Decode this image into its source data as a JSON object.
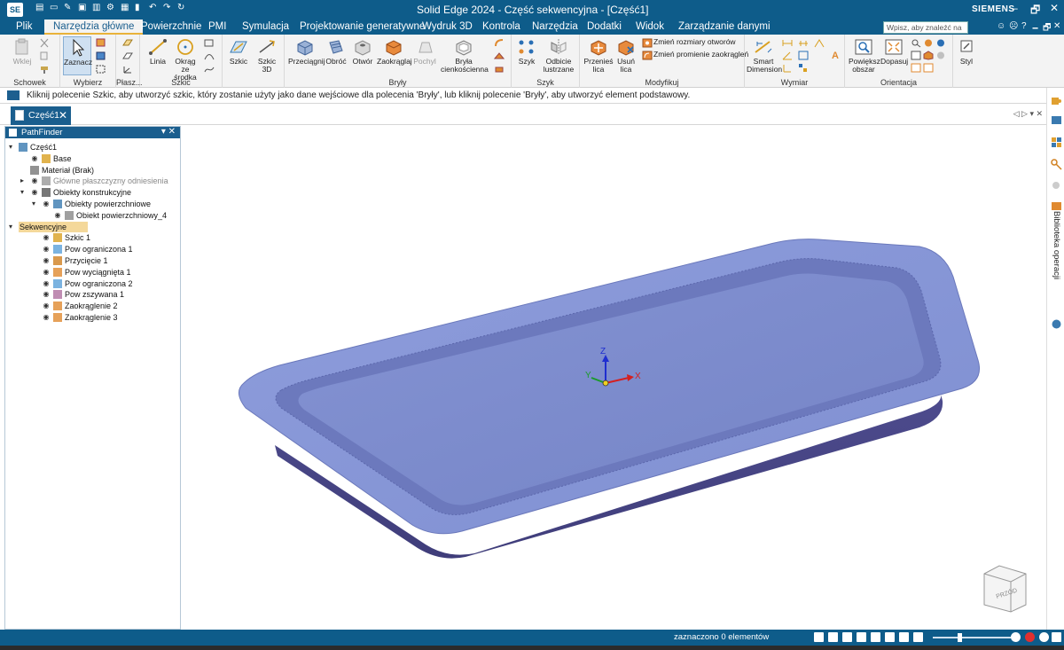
{
  "app": {
    "logo": "SE",
    "title": "Solid Edge 2024 - Część sekwencyjna - [Część1]",
    "brand": "SIEMENS",
    "window_controls": [
      "–",
      "🗗",
      "✕"
    ]
  },
  "menu": {
    "tabs": [
      "Plik",
      "Narzędzia główne",
      "Powierzchnie",
      "PMI",
      "Symulacja",
      "Projektowanie generatywne",
      "Wydruk 3D",
      "Kontrola",
      "Narzędzia",
      "Dodatki",
      "Widok",
      "Zarządzanie danymi"
    ],
    "active_tab": "Narzędzia główne",
    "search_placeholder": "Wpisz, aby znaleźć na",
    "right_controls": [
      "🗕",
      "🗗",
      "✕"
    ]
  },
  "ribbon": {
    "groups": {
      "schowek": "Schowek",
      "wybierz": "Wybierz",
      "plasz": "Płasz...",
      "szkic": "Szkic",
      "bryly": "Bryły",
      "szyk": "Szyk",
      "modyfikuj": "Modyfikuj",
      "wymiar": "Wymiar",
      "orientacja": "Orientacja"
    },
    "buttons": {
      "wklej": "Wklej",
      "zaznacz": "Zaznacz",
      "linia": "Linia",
      "okrag_line1": "Okrąg ze",
      "okrag_line2": "środka",
      "szkic": "Szkic",
      "szkic3d_line1": "Szkic",
      "szkic3d_line2": "3D",
      "przeciagnij": "Przeciągnij",
      "obroc": "Obróć",
      "otwor": "Otwór",
      "zaokraglaj": "Zaokrąglaj",
      "pochyl": "Pochyl",
      "bryla_line1": "Bryła",
      "bryla_line2": "cienkościenna",
      "szyk": "Szyk",
      "odbicie_line1": "Odbicie",
      "odbicie_line2": "lustrzane",
      "przenies_line1": "Przenieś",
      "przenies_line2": "lica",
      "usun_line1": "Usuń",
      "usun_line2": "lica",
      "zmien_rozmiary": "Zmień rozmiary otworów",
      "zmien_promienie": "Zmień promienie zaokrągleń",
      "smart_line1": "Smart",
      "smart_line2": "Dimension",
      "powieksz_line1": "Powiększ",
      "powieksz_line2": "obszar",
      "dopasuj": "Dopasuj",
      "styl": "Styl"
    }
  },
  "prompt": {
    "text": "Kliknij polecenie Szkic, aby utworzyć szkic, który zostanie użyty jako dane wejściowe dla polecenia 'Bryły', lub kliknij polecenie 'Bryły', aby utworzyć element podstawowy."
  },
  "document_tab": {
    "label": "Część1",
    "nav": "◁ ▷ ▾ ✕"
  },
  "pathfinder": {
    "title": "PathFinder",
    "tools": "▾ ✕",
    "items": [
      {
        "label": "Część1",
        "level": 0,
        "twisty": "▾",
        "eye": false
      },
      {
        "label": "Base",
        "level": 1,
        "twisty": "",
        "eye": true
      },
      {
        "label": "Materiał (Brak)",
        "level": 1,
        "twisty": "",
        "eye": false
      },
      {
        "label": "Główne płaszczyzny odniesienia",
        "level": 1,
        "twisty": "▸",
        "eye": true,
        "dim": true
      },
      {
        "label": "Obiekty konstrukcyjne",
        "level": 1,
        "twisty": "▾",
        "eye": true
      },
      {
        "label": "Obiekty powierzchniowe",
        "level": 2,
        "twisty": "▾",
        "eye": true
      },
      {
        "label": "Obiekt powierzchniowy_4",
        "level": 3,
        "twisty": "",
        "eye": true
      },
      {
        "label": "Sekwencyjne",
        "level": 0,
        "twisty": "▾",
        "eye": false,
        "highlight": true
      },
      {
        "label": "Szkic 1",
        "level": 2,
        "twisty": "",
        "eye": true
      },
      {
        "label": "Pow ograniczona 1",
        "level": 2,
        "twisty": "",
        "eye": true
      },
      {
        "label": "Przycięcie 1",
        "level": 2,
        "twisty": "",
        "eye": true
      },
      {
        "label": "Pow wyciągnięta 1",
        "level": 2,
        "twisty": "",
        "eye": true
      },
      {
        "label": "Pow ograniczona 2",
        "level": 2,
        "twisty": "",
        "eye": true
      },
      {
        "label": "Pow zszywana 1",
        "level": 2,
        "twisty": "",
        "eye": true
      },
      {
        "label": "Zaokrąglenie 2",
        "level": 2,
        "twisty": "",
        "eye": true
      },
      {
        "label": "Zaokrąglenie 3",
        "level": 2,
        "twisty": "",
        "eye": true
      }
    ]
  },
  "right_dock": {
    "library_label": "Biblioteka operacji"
  },
  "viewport": {
    "axis_x": "X",
    "axis_y": "Y",
    "axis_z": "Z",
    "view_cube_label": "PRZÓD",
    "model_color": "#8c9ad6",
    "model_side_color": "#4e4c8e"
  },
  "status": {
    "text": "zaznaczono 0 elementów"
  },
  "colors": {
    "titlebar": "#0e5c8a",
    "accent": "#e9b23a",
    "statusbar": "#0e5c8a"
  }
}
